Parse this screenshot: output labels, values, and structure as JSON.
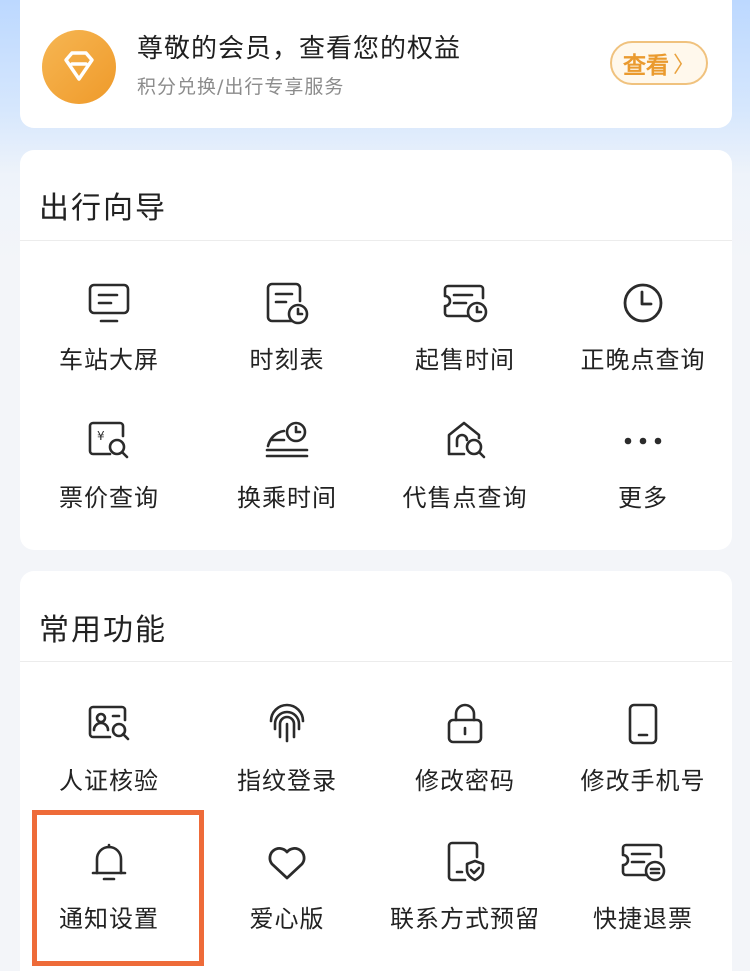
{
  "member": {
    "title": "尊敬的会员，查看您的权益",
    "subtitle": "积分兑换/出行专享服务",
    "button_label": "查看",
    "button_chevron": "〉"
  },
  "travel_guide": {
    "title": "出行向导",
    "items": [
      {
        "label": "车站大屏",
        "icon": "monitor-icon"
      },
      {
        "label": "时刻表",
        "icon": "timetable-icon"
      },
      {
        "label": "起售时间",
        "icon": "ticket-clock-icon"
      },
      {
        "label": "正晚点查询",
        "icon": "clock-icon"
      },
      {
        "label": "票价查询",
        "icon": "fare-search-icon"
      },
      {
        "label": "换乘时间",
        "icon": "transfer-time-icon"
      },
      {
        "label": "代售点查询",
        "icon": "agency-search-icon"
      },
      {
        "label": "更多",
        "icon": "more-icon"
      }
    ]
  },
  "common_functions": {
    "title": "常用功能",
    "items": [
      {
        "label": "人证核验",
        "icon": "id-verify-icon"
      },
      {
        "label": "指纹登录",
        "icon": "fingerprint-icon"
      },
      {
        "label": "修改密码",
        "icon": "lock-icon"
      },
      {
        "label": "修改手机号",
        "icon": "phone-icon"
      },
      {
        "label": "通知设置",
        "icon": "bell-icon"
      },
      {
        "label": "爱心版",
        "icon": "heart-icon"
      },
      {
        "label": "联系方式预留",
        "icon": "contact-shield-icon"
      },
      {
        "label": "快捷退票",
        "icon": "ticket-refund-icon"
      }
    ]
  },
  "colors": {
    "accent": "#ea9a2e",
    "highlight_box": "#ee6b39",
    "icon_stroke": "#2b2b2b"
  }
}
